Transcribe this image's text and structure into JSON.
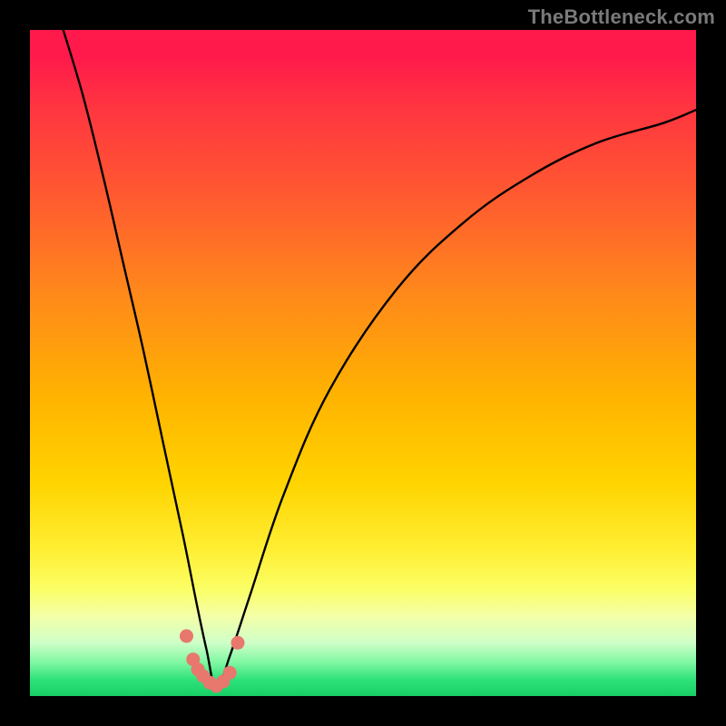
{
  "watermark": "TheBottleneck.com",
  "colors": {
    "curve_stroke": "#000000",
    "marker_fill": "#e8776e",
    "background": "#000000"
  },
  "chart_data": {
    "type": "line",
    "title": "",
    "xlabel": "",
    "ylabel": "",
    "xlim": [
      0,
      100
    ],
    "ylim": [
      0,
      100
    ],
    "grid": false,
    "legend": false,
    "notes": "Unlabeled bottleneck-style curve. Background is a vertical rainbow gradient from red (top, high bottleneck) to green (bottom, low bottleneck). The black curve is a V-shaped line reaching the green band near x≈28 and rising steeply on both sides toward red. A few salmon-colored marker dots sit near the trough. Values are visual estimates from pixel positions; axes carry no tick labels.",
    "series": [
      {
        "name": "bottleneck_curve_left_branch",
        "x": [
          5,
          8,
          11,
          14,
          17,
          20,
          23,
          25,
          26.5,
          28
        ],
        "y": [
          100,
          90,
          78,
          65,
          52,
          38,
          24,
          14,
          7,
          1
        ]
      },
      {
        "name": "bottleneck_curve_right_branch",
        "x": [
          28,
          30,
          33,
          38,
          45,
          55,
          65,
          75,
          85,
          95,
          100
        ],
        "y": [
          1,
          6,
          15,
          30,
          46,
          61,
          71,
          78,
          83,
          86,
          88
        ]
      }
    ],
    "markers": {
      "name": "trough_points",
      "x": [
        23.5,
        24.5,
        25.2,
        26.0,
        27.0,
        28.0,
        29.0,
        30.0,
        31.2
      ],
      "y": [
        9.0,
        5.5,
        4.0,
        3.0,
        2.0,
        1.5,
        2.2,
        3.5,
        8.0
      ]
    }
  }
}
